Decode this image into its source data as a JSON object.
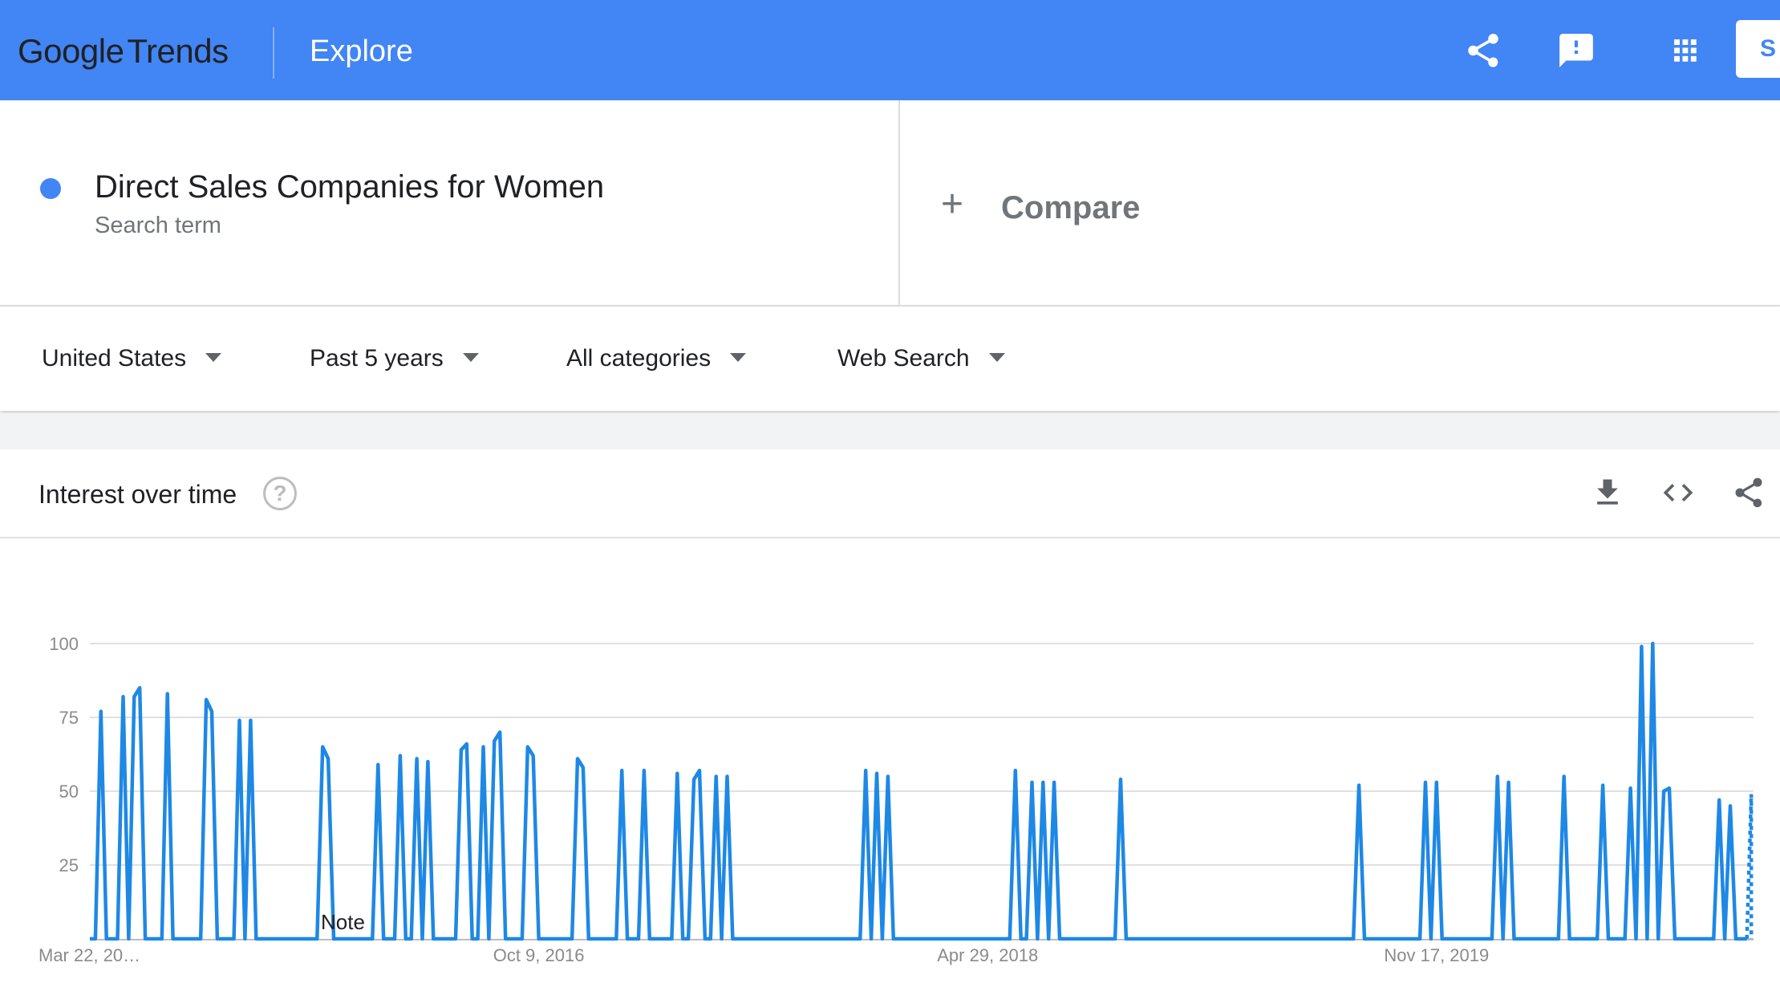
{
  "header": {
    "brand": "Google",
    "product": "Trends",
    "page": "Explore",
    "signin_label": "S",
    "icons": [
      "share-icon",
      "feedback-icon",
      "apps-icon"
    ]
  },
  "search_term": {
    "name": "Direct Sales Companies for Women",
    "type": "Search term",
    "color": "#4285f4"
  },
  "compare": {
    "plus": "+",
    "label": "Compare"
  },
  "filters": {
    "region": "United States",
    "time_range": "Past 5 years",
    "category": "All categories",
    "search_type": "Web Search"
  },
  "interest_over_time": {
    "title": "Interest over time",
    "help": "?",
    "note": "Note"
  },
  "chart_data": {
    "type": "line",
    "title": "Interest over time",
    "xlabel": "",
    "ylabel": "",
    "ylim": [
      0,
      100
    ],
    "yticks": [
      "100",
      "75",
      "50",
      "25"
    ],
    "xticks": [
      "Mar 22, 20…",
      "Oct 9, 2016",
      "Apr 29, 2018",
      "Nov 17, 2019"
    ],
    "grid": true,
    "series": [
      {
        "color": "#1e88e5",
        "x_weeks": [
          0,
          1,
          2,
          3,
          4,
          5,
          6,
          7,
          8,
          9,
          10,
          11,
          12,
          13,
          14,
          15,
          16,
          17,
          18,
          19,
          20,
          21,
          22,
          23,
          24,
          25,
          26,
          27,
          28,
          29,
          30,
          31,
          32,
          33,
          34,
          35,
          36,
          37,
          38,
          39,
          40,
          41,
          42,
          43,
          44,
          45,
          46,
          47,
          48,
          49,
          50,
          51,
          52,
          53,
          54,
          55,
          56,
          57,
          58,
          59,
          60,
          61,
          62,
          63,
          64,
          65,
          66,
          67,
          68,
          69,
          70,
          71,
          72,
          73,
          74,
          75,
          76,
          77,
          78,
          79,
          80,
          81,
          82,
          83,
          84,
          85,
          86,
          87,
          88,
          89,
          90,
          91,
          92,
          93,
          94,
          95,
          96,
          97,
          98,
          99,
          100,
          101,
          102,
          103,
          104,
          105,
          106,
          107,
          108,
          109,
          110,
          111,
          112,
          113,
          114,
          115,
          116,
          117,
          118,
          119,
          120,
          121,
          122,
          123,
          124,
          125,
          126,
          127,
          128,
          129,
          130,
          131,
          132,
          133,
          134,
          135,
          136,
          137,
          138,
          139,
          140,
          141,
          142,
          143,
          144,
          145,
          146,
          147,
          148,
          149,
          150,
          151,
          152,
          153,
          154,
          155,
          156,
          157,
          158,
          159,
          160,
          161,
          162,
          163,
          164,
          165,
          166,
          167,
          168,
          169,
          170,
          171,
          172,
          173,
          174,
          175,
          176,
          177,
          178,
          179,
          180,
          181,
          182,
          183,
          184,
          185,
          186,
          187,
          188,
          189,
          190,
          191,
          192,
          193,
          194,
          195,
          196,
          197,
          198,
          199,
          200,
          201,
          202,
          203,
          204,
          205,
          206,
          207,
          208,
          209,
          210,
          211,
          212,
          213,
          214,
          215,
          216,
          217,
          218,
          219,
          220,
          221,
          222,
          223,
          224,
          225,
          226,
          227,
          228,
          229,
          230,
          231,
          232,
          233,
          234,
          235,
          236,
          237,
          238,
          239,
          240,
          241,
          242,
          243,
          244,
          245,
          246,
          247,
          248,
          249,
          250,
          251,
          252,
          253,
          254,
          255,
          256,
          257,
          258,
          259,
          260
        ],
        "values": [
          0,
          0,
          77,
          0,
          0,
          0,
          82,
          0,
          82,
          85,
          0,
          0,
          0,
          0,
          83,
          0,
          0,
          0,
          0,
          0,
          0,
          81,
          77,
          0,
          0,
          0,
          0,
          74,
          0,
          74,
          0,
          0,
          0,
          0,
          0,
          0,
          0,
          0,
          0,
          0,
          0,
          0,
          65,
          61,
          0,
          0,
          0,
          0,
          0,
          0,
          0,
          0,
          59,
          0,
          0,
          0,
          62,
          0,
          0,
          61,
          0,
          60,
          0,
          0,
          0,
          0,
          0,
          64,
          66,
          0,
          0,
          65,
          0,
          67,
          70,
          0,
          0,
          0,
          0,
          65,
          62,
          0,
          0,
          0,
          0,
          0,
          0,
          0,
          61,
          58,
          0,
          0,
          0,
          0,
          0,
          0,
          57,
          0,
          0,
          0,
          57,
          0,
          0,
          0,
          0,
          0,
          56,
          0,
          0,
          54,
          57,
          0,
          0,
          55,
          0,
          55,
          0,
          0,
          0,
          0,
          0,
          0,
          0,
          0,
          0,
          0,
          0,
          0,
          0,
          0,
          0,
          0,
          0,
          0,
          0,
          0,
          0,
          0,
          0,
          0,
          57,
          0,
          56,
          0,
          55,
          0,
          0,
          0,
          0,
          0,
          0,
          0,
          0,
          0,
          0,
          0,
          0,
          0,
          0,
          0,
          0,
          0,
          0,
          0,
          0,
          0,
          0,
          57,
          0,
          0,
          53,
          0,
          53,
          0,
          53,
          0,
          0,
          0,
          0,
          0,
          0,
          0,
          0,
          0,
          0,
          0,
          54,
          0,
          0,
          0,
          0,
          0,
          0,
          0,
          0,
          0,
          0,
          0,
          0,
          0,
          0,
          0,
          0,
          0,
          0,
          0,
          0,
          0,
          0,
          0,
          0,
          0,
          0,
          0,
          0,
          0,
          0,
          0,
          0,
          0,
          0,
          0,
          0,
          0,
          0,
          0,
          0,
          0,
          0,
          52,
          0,
          0,
          0,
          0,
          0,
          0,
          0,
          0,
          0,
          0,
          0,
          53,
          0,
          53,
          0,
          0,
          0,
          0,
          0,
          0,
          0,
          0,
          0,
          0,
          55,
          0,
          53,
          0,
          0,
          0,
          0,
          0,
          0,
          0,
          0,
          0,
          55,
          0,
          0,
          0,
          0,
          0,
          0,
          52,
          0,
          0,
          0,
          0,
          51,
          0,
          99,
          0,
          100,
          0,
          50,
          51,
          0,
          0,
          0,
          0,
          0,
          0,
          0,
          0,
          47,
          0,
          45,
          0,
          0,
          0
        ]
      }
    ],
    "partial_last_point": 49
  }
}
